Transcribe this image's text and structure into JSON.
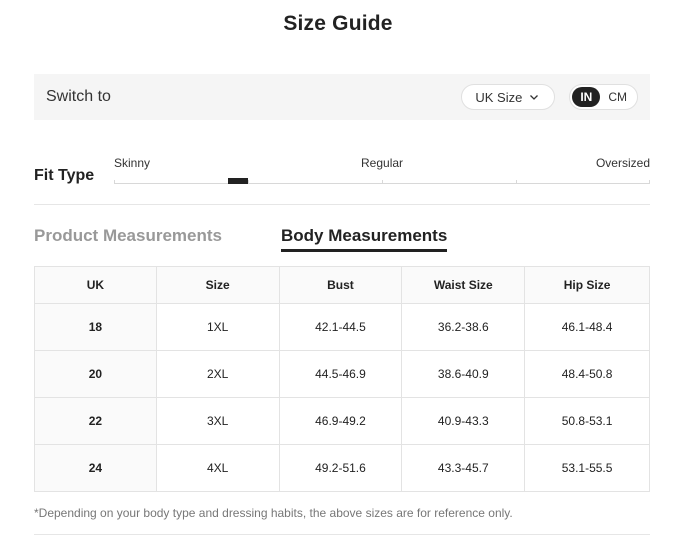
{
  "title": "Size Guide",
  "switch": {
    "label": "Switch to",
    "size_system": "UK Size",
    "units": [
      {
        "label": "IN",
        "active": true
      },
      {
        "label": "CM",
        "active": false
      }
    ]
  },
  "fit": {
    "title": "Fit Type",
    "labels": [
      "Skinny",
      "Regular",
      "Oversized"
    ],
    "level": 0.25
  },
  "tabs": [
    {
      "label": "Product Measurements",
      "active": false
    },
    {
      "label": "Body Measurements",
      "active": true
    }
  ],
  "table": {
    "headers": [
      "UK",
      "Size",
      "Bust",
      "Waist Size",
      "Hip Size"
    ],
    "rows": [
      [
        "18",
        "1XL",
        "42.1-44.5",
        "36.2-38.6",
        "46.1-48.4"
      ],
      [
        "20",
        "2XL",
        "44.5-46.9",
        "38.6-40.9",
        "48.4-50.8"
      ],
      [
        "22",
        "3XL",
        "46.9-49.2",
        "40.9-43.3",
        "50.8-53.1"
      ],
      [
        "24",
        "4XL",
        "49.2-51.6",
        "43.3-45.7",
        "53.1-55.5"
      ]
    ]
  },
  "note": "*Depending on your body type and dressing habits, the above sizes are for reference only."
}
